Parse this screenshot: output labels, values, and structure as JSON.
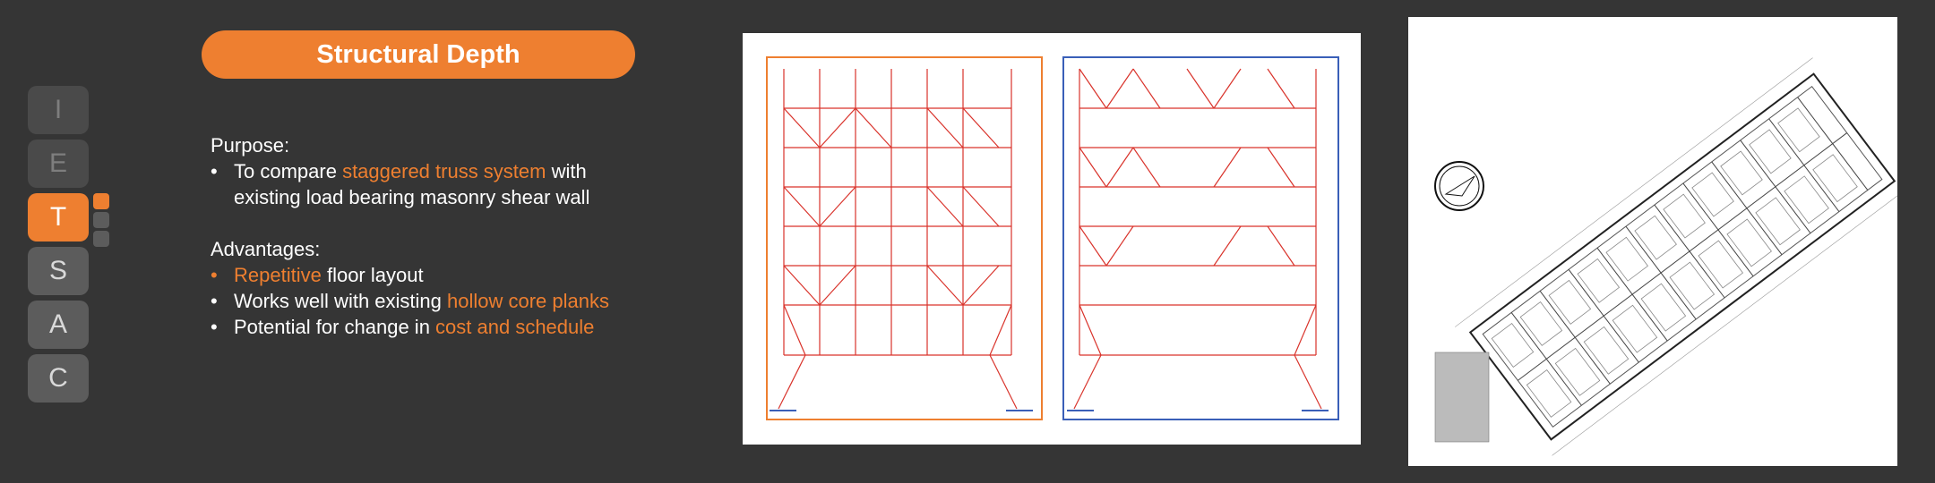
{
  "nav": {
    "items": [
      {
        "letter": "I",
        "state": "dim"
      },
      {
        "letter": "E",
        "state": "dim"
      },
      {
        "letter": "T",
        "state": "active"
      },
      {
        "letter": "S",
        "state": "normal"
      },
      {
        "letter": "A",
        "state": "normal"
      },
      {
        "letter": "C",
        "state": "normal"
      }
    ]
  },
  "title": "Structural Depth",
  "purpose": {
    "heading": "Purpose:",
    "line1_pre": "To compare ",
    "line1_highlight": "staggered truss system",
    "line1_post": " with",
    "line2": "existing load bearing masonry shear wall"
  },
  "advantages": {
    "heading": "Advantages:",
    "items": [
      {
        "highlight_first": "Repetitive",
        "rest": " floor layout"
      },
      {
        "pre": "Works well with existing ",
        "highlight": "hollow core planks"
      },
      {
        "pre": "Potential for change in ",
        "highlight": "cost and schedule"
      }
    ]
  },
  "colors": {
    "accent": "#ee7f30",
    "background": "#353535",
    "truss_red": "#d9332b",
    "frame_blue": "#3a5fb8"
  },
  "icons": {
    "bullet": "•",
    "north_arrow": "north-arrow-icon"
  }
}
